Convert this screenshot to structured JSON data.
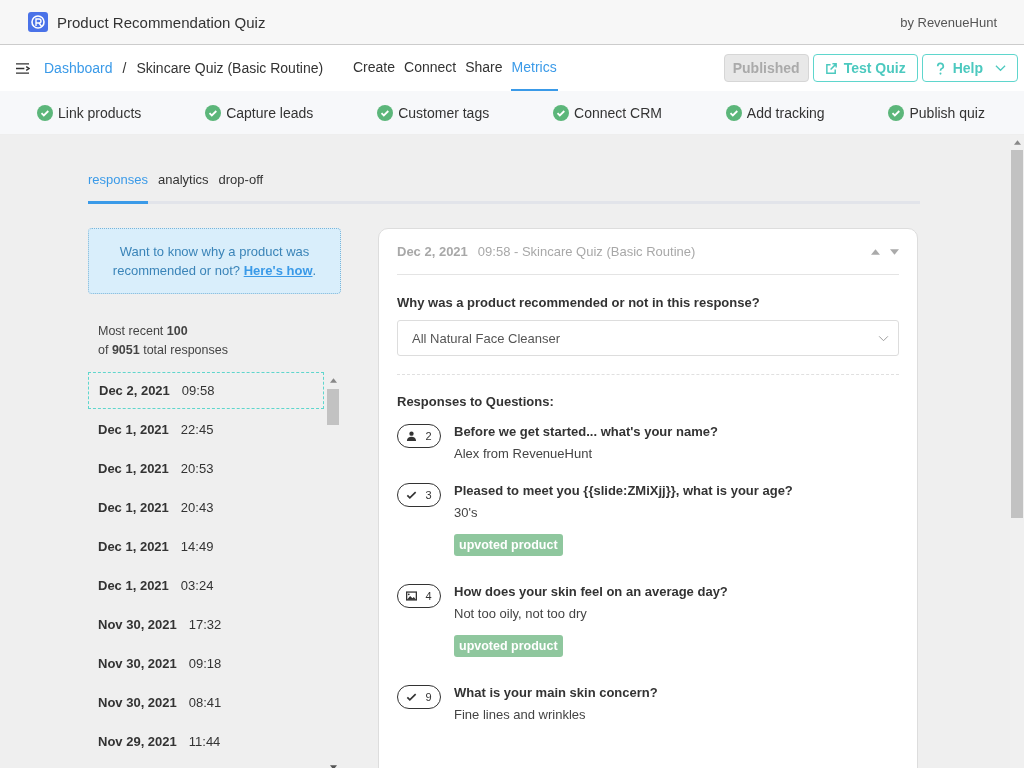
{
  "app": {
    "title": "Product Recommendation Quiz",
    "vendor": "by RevenueHunt"
  },
  "nav": {
    "breadcrumb_separator": "/",
    "breadcrumb": [
      {
        "label": "Dashboard",
        "link": true
      },
      {
        "label": "Skincare Quiz (Basic Routine)",
        "link": false
      }
    ],
    "tabs": [
      {
        "label": "Create",
        "selected": false
      },
      {
        "label": "Connect",
        "selected": false
      },
      {
        "label": "Share",
        "selected": false
      },
      {
        "label": "Metrics",
        "selected": true
      }
    ],
    "buttons": [
      {
        "label": "Published",
        "kind": "disabled"
      },
      {
        "label": "Test Quiz",
        "kind": "external"
      },
      {
        "label": "Help",
        "kind": "help"
      }
    ]
  },
  "checklist": [
    {
      "label": "Link products",
      "done": true
    },
    {
      "label": "Capture leads",
      "done": true
    },
    {
      "label": "Customer tags",
      "done": true
    },
    {
      "label": "Connect CRM",
      "done": true
    },
    {
      "label": "Add tracking",
      "done": true
    },
    {
      "label": "Publish quiz",
      "done": true
    }
  ],
  "subtabs": [
    {
      "label": "responses",
      "selected": true
    },
    {
      "label": "analytics",
      "selected": false
    },
    {
      "label": "drop-off",
      "selected": false
    }
  ],
  "info": {
    "text": "Want to know why a product was recommended or not?",
    "link": "Here's how",
    "after": "."
  },
  "summary": {
    "line1": "Most recent **100**",
    "line2": "of **9051** total responses"
  },
  "responses": [
    {
      "date": "Dec 2, 2021",
      "time": "09:58",
      "selected": true
    },
    {
      "date": "Dec 1, 2021",
      "time": "22:45",
      "selected": false
    },
    {
      "date": "Dec 1, 2021",
      "time": "20:53",
      "selected": false
    },
    {
      "date": "Dec 1, 2021",
      "time": "20:43",
      "selected": false
    },
    {
      "date": "Dec 1, 2021",
      "time": "14:49",
      "selected": false
    },
    {
      "date": "Dec 1, 2021",
      "time": "03:24",
      "selected": false
    },
    {
      "date": "Nov 30, 2021",
      "time": "17:32",
      "selected": false
    },
    {
      "date": "Nov 30, 2021",
      "time": "09:18",
      "selected": false
    },
    {
      "date": "Nov 30, 2021",
      "time": "08:41",
      "selected": false
    },
    {
      "date": "Nov 29, 2021",
      "time": "11:44",
      "selected": false
    }
  ],
  "detail": {
    "date": "Dec 2, 2021",
    "subtitle": "09:58 - Skincare Quiz (Basic Routine)",
    "question": "Why was a product recommended or not in this response?",
    "select_value": "All Natural Face Cleanser",
    "section": "Responses to Questions:",
    "questions": [
      {
        "kind": "person",
        "number": "2",
        "text": "Before we get started... what's your name?",
        "answer": "Alex from RevenueHunt"
      },
      {
        "kind": "check",
        "number": "3",
        "text": "Pleased to meet you {{slide:ZMiXjj}}, what is your age?",
        "answer": "30's",
        "tag": "upvoted product"
      },
      {
        "kind": "image",
        "number": "4",
        "text": "How does your skin feel on an average day?",
        "answer": "Not too oily, not too dry",
        "tag": "upvoted product"
      },
      {
        "kind": "check",
        "number": "9",
        "text": "What is your main skin concern?",
        "answer": "Fine lines and wrinkles"
      }
    ]
  }
}
